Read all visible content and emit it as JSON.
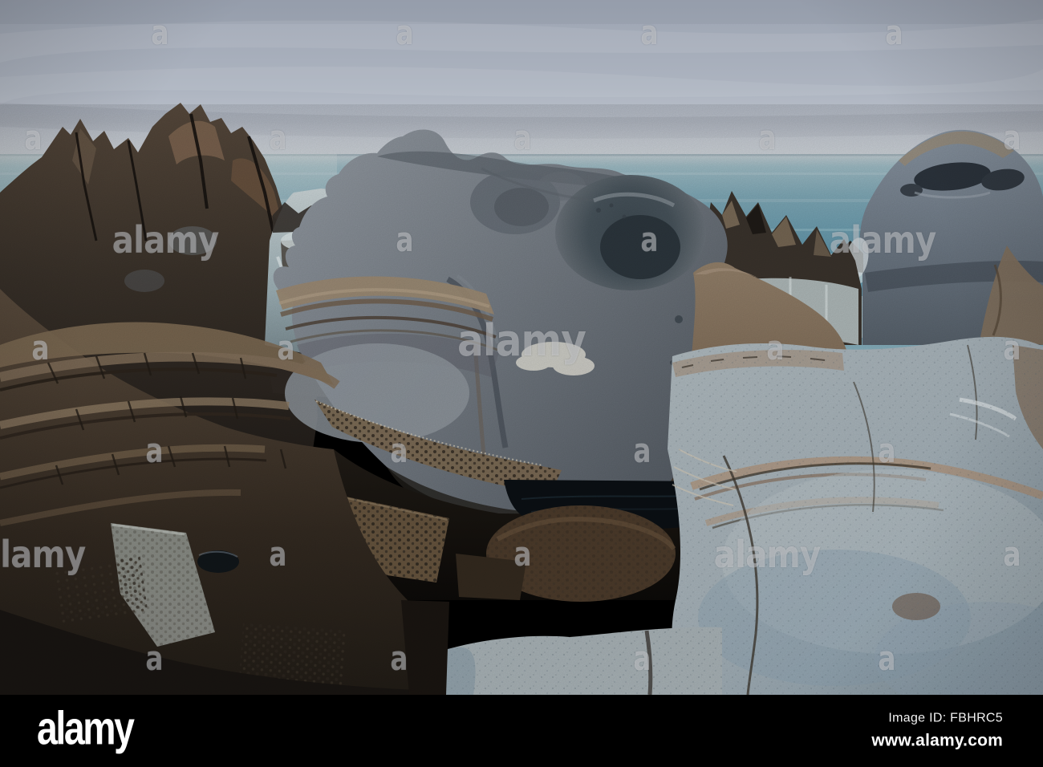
{
  "image": {
    "subject": "Sculpted grey sandstone boulders and dark rocky shoreline with overcast sky and teal sea",
    "style": "long-exposure coastal photograph"
  },
  "palette": {
    "sky_top": "#9ca4b2",
    "sky_horizon": "#c8cdd5",
    "sea_deep": "#6397ab",
    "sea_pale": "#9ebbc4",
    "foam": "#d7e2e3",
    "cliff_brown": "#57493c",
    "cliff_dark": "#241f1b",
    "boulder_grey": "#747b83",
    "hollow_grey": "#3c4850",
    "lip_tan": "#9c8a73",
    "tafoni_tan": "#93806a",
    "slab_pale": "#b6c0c4",
    "slab_pink": "#b2977f",
    "cave_dark": "#0e0c08",
    "pool_black": "#0b1014",
    "bar_black": "#000000",
    "watermark_white": "#ffffff"
  },
  "watermark": {
    "letter": "a",
    "word": "alamy"
  },
  "footer": {
    "logo_text": "alamy",
    "image_id": "Image ID: FBHRC5",
    "website": "www.alamy.com"
  }
}
